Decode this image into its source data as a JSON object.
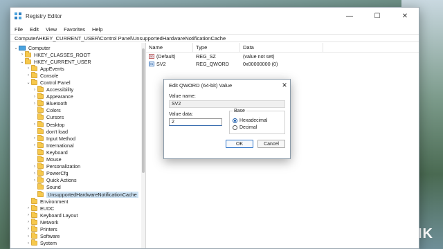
{
  "window": {
    "title": "Registry Editor",
    "controls": {
      "minimize": "—",
      "maximize": "☐",
      "close": "✕"
    }
  },
  "menu": [
    "File",
    "Edit",
    "View",
    "Favorites",
    "Help"
  ],
  "address": "Computer\\HKEY_CURRENT_USER\\Control Panel\\UnsupportedHardwareNotificationCache",
  "tree": [
    {
      "label": "Computer",
      "indent": 0,
      "chev": "⌄",
      "icon": "computer-icon"
    },
    {
      "label": "HKEY_CLASSES_ROOT",
      "indent": 1,
      "chev": "›",
      "icon": "folder-icon"
    },
    {
      "label": "HKEY_CURRENT_USER",
      "indent": 1,
      "chev": "⌄",
      "icon": "folder-icon"
    },
    {
      "label": "AppEvents",
      "indent": 2,
      "chev": "›",
      "icon": "folder-icon"
    },
    {
      "label": "Console",
      "indent": 2,
      "chev": "›",
      "icon": "folder-icon"
    },
    {
      "label": "Control Panel",
      "indent": 2,
      "chev": "⌄",
      "icon": "folder-icon"
    },
    {
      "label": "Accessibility",
      "indent": 3,
      "chev": "›",
      "icon": "folder-icon"
    },
    {
      "label": "Appearance",
      "indent": 3,
      "chev": "›",
      "icon": "folder-icon"
    },
    {
      "label": "Bluetooth",
      "indent": 3,
      "chev": "›",
      "icon": "folder-icon"
    },
    {
      "label": "Colors",
      "indent": 3,
      "chev": "",
      "icon": "folder-icon"
    },
    {
      "label": "Cursors",
      "indent": 3,
      "chev": "",
      "icon": "folder-icon"
    },
    {
      "label": "Desktop",
      "indent": 3,
      "chev": "›",
      "icon": "folder-icon"
    },
    {
      "label": "don't load",
      "indent": 3,
      "chev": "",
      "icon": "folder-icon"
    },
    {
      "label": "Input Method",
      "indent": 3,
      "chev": "›",
      "icon": "folder-icon"
    },
    {
      "label": "International",
      "indent": 3,
      "chev": "›",
      "icon": "folder-icon"
    },
    {
      "label": "Keyboard",
      "indent": 3,
      "chev": "",
      "icon": "folder-icon"
    },
    {
      "label": "Mouse",
      "indent": 3,
      "chev": "",
      "icon": "folder-icon"
    },
    {
      "label": "Personalization",
      "indent": 3,
      "chev": "›",
      "icon": "folder-icon"
    },
    {
      "label": "PowerCfg",
      "indent": 3,
      "chev": "›",
      "icon": "folder-icon"
    },
    {
      "label": "Quick Actions",
      "indent": 3,
      "chev": "›",
      "icon": "folder-icon"
    },
    {
      "label": "Sound",
      "indent": 3,
      "chev": "",
      "icon": "folder-icon"
    },
    {
      "label": "UnsupportedHardwareNotificationCache",
      "indent": 3,
      "chev": "",
      "icon": "folder-icon",
      "selected": true
    },
    {
      "label": "Environment",
      "indent": 2,
      "chev": "",
      "icon": "folder-icon"
    },
    {
      "label": "EUDC",
      "indent": 2,
      "chev": "›",
      "icon": "folder-icon"
    },
    {
      "label": "Keyboard Layout",
      "indent": 2,
      "chev": "›",
      "icon": "folder-icon"
    },
    {
      "label": "Network",
      "indent": 2,
      "chev": "›",
      "icon": "folder-icon"
    },
    {
      "label": "Printers",
      "indent": 2,
      "chev": "›",
      "icon": "folder-icon"
    },
    {
      "label": "Software",
      "indent": 2,
      "chev": "›",
      "icon": "folder-icon"
    },
    {
      "label": "System",
      "indent": 2,
      "chev": "›",
      "icon": "folder-icon"
    }
  ],
  "values_pane": {
    "headers": {
      "name": "Name",
      "type": "Type",
      "data": "Data"
    },
    "rows": [
      {
        "icon": "string-value-icon",
        "icon_text": "ab",
        "name": "(Default)",
        "type": "REG_SZ",
        "data": "(value not set)"
      },
      {
        "icon": "binary-value-icon",
        "icon_text": "01",
        "name": "SV2",
        "type": "REG_QWORD",
        "data": "0x00000000 (0)"
      }
    ]
  },
  "dialog": {
    "title": "Edit QWORD (64-bit) Value",
    "close": "✕",
    "value_name_label": "Value name:",
    "value_name": "SV2",
    "value_data_label": "Value data:",
    "value_data": "2",
    "base_label": "Base",
    "radio_hex": "Hexadecimal",
    "radio_dec": "Decimal",
    "selected_base": "Hexadecimal",
    "ok": "OK",
    "cancel": "Cancel"
  },
  "watermark": "GENK"
}
